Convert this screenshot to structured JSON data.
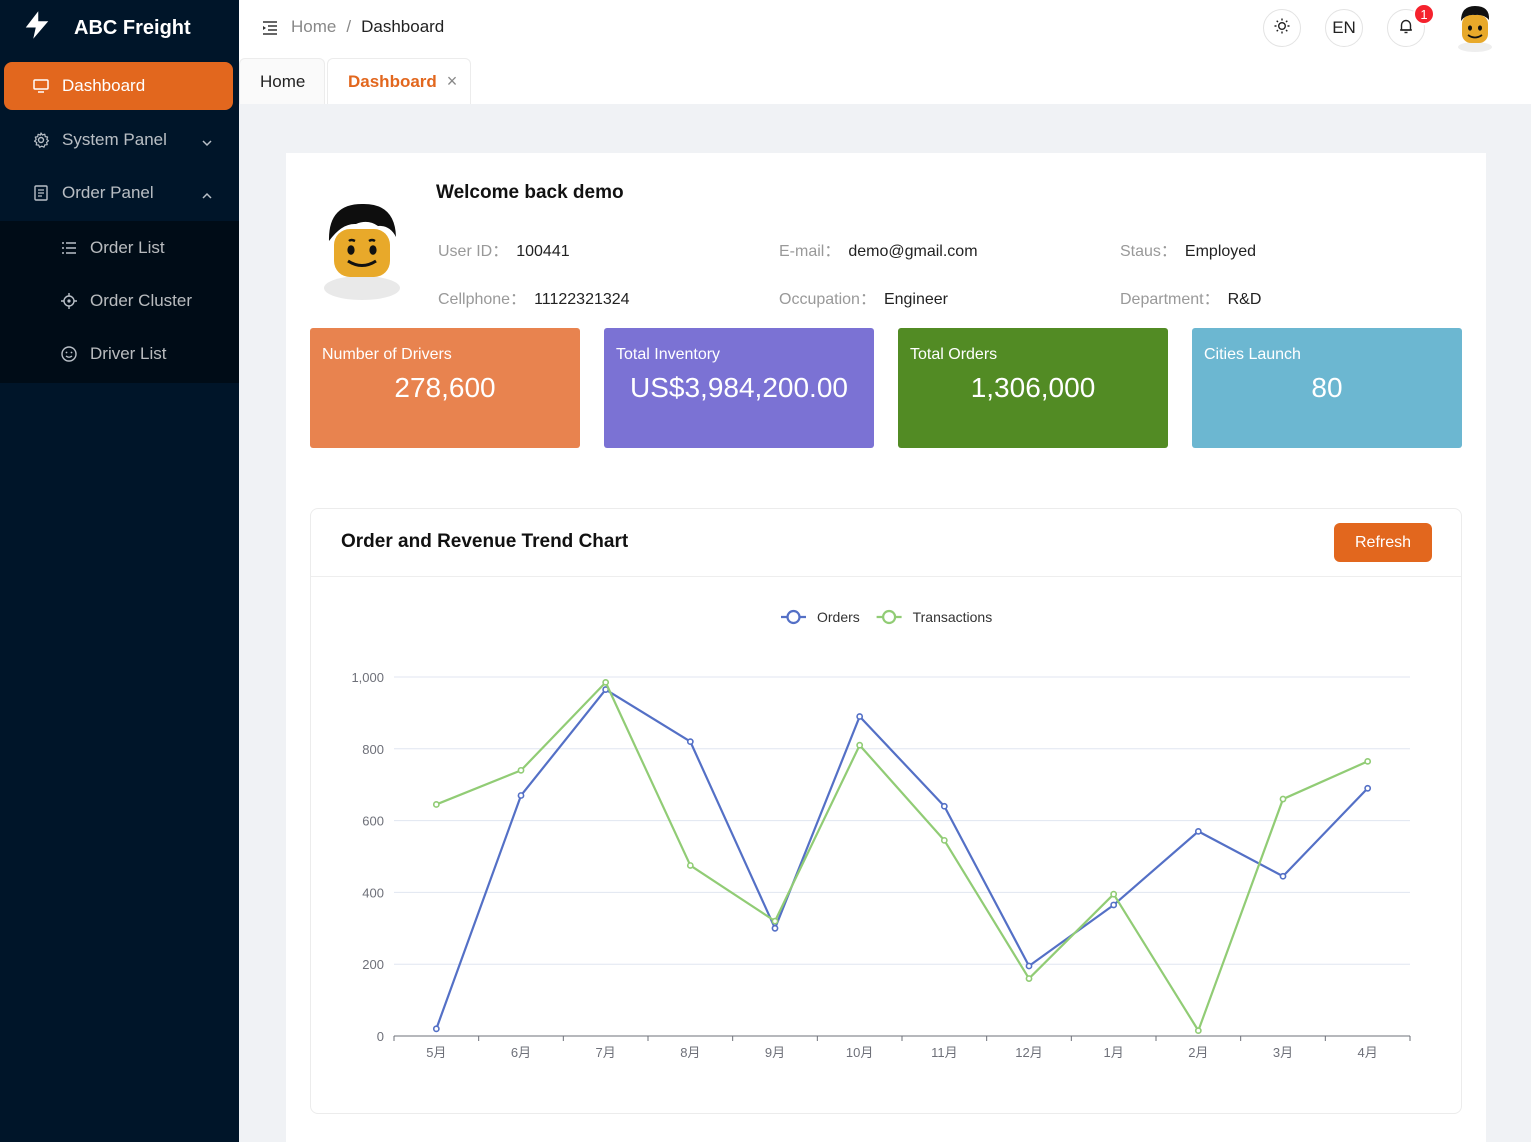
{
  "app": {
    "name": "ABC Freight"
  },
  "sidebar": {
    "items": [
      {
        "label": "Dashboard",
        "icon": "monitor-icon",
        "active": true
      },
      {
        "label": "System Panel",
        "icon": "gear-icon"
      },
      {
        "label": "Order Panel",
        "icon": "document-icon",
        "expanded": true
      }
    ],
    "subitems": [
      {
        "label": "Order List",
        "icon": "list-icon"
      },
      {
        "label": "Order Cluster",
        "icon": "target-icon"
      },
      {
        "label": "Driver List",
        "icon": "smile-icon"
      }
    ]
  },
  "header": {
    "breadcrumb": [
      "Home",
      "/",
      "Dashboard"
    ],
    "language": "EN",
    "notification_count": "1"
  },
  "tabs": [
    {
      "label": "Home"
    },
    {
      "label": "Dashboard",
      "close": "×",
      "active": true
    }
  ],
  "profile": {
    "welcome": "Welcome back demo",
    "fields": [
      {
        "label": "User ID：",
        "value": "100441"
      },
      {
        "label": "E-mail：",
        "value": "demo@gmail.com"
      },
      {
        "label": "Staus：",
        "value": "Employed"
      },
      {
        "label": "Cellphone：",
        "value": "11122321324"
      },
      {
        "label": "Occupation：",
        "value": "Engineer"
      },
      {
        "label": "Department：",
        "value": "R&D"
      }
    ]
  },
  "stats": [
    {
      "label": "Number of Drivers",
      "value": "278,600",
      "color": "#e8834f"
    },
    {
      "label": "Total Inventory",
      "value": "US$3,984,200.00",
      "color": "#7b72d4"
    },
    {
      "label": "Total Orders",
      "value": "1,306,000",
      "color": "#528b24"
    },
    {
      "label": "Cities Launch",
      "value": "80",
      "color": "#6cb7d1"
    }
  ],
  "chart_section": {
    "title": "Order and Revenue Trend Chart",
    "refresh_label": "Refresh"
  },
  "chart_data": {
    "type": "line",
    "categories": [
      "5月",
      "6月",
      "7月",
      "8月",
      "9月",
      "10月",
      "11月",
      "12月",
      "1月",
      "2月",
      "3月",
      "4月"
    ],
    "series": [
      {
        "name": "Orders",
        "color": "#5470c6",
        "values": [
          20,
          670,
          965,
          820,
          300,
          890,
          640,
          195,
          365,
          570,
          445,
          690
        ]
      },
      {
        "name": "Transactions",
        "color": "#91cc75",
        "values": [
          645,
          740,
          985,
          475,
          320,
          810,
          545,
          160,
          395,
          15,
          660,
          765
        ]
      }
    ],
    "ylim": [
      0,
      1000
    ],
    "yticks": [
      "0",
      "200",
      "400",
      "600",
      "800",
      "1,000"
    ],
    "grid": true,
    "legend_position": "top-center"
  }
}
